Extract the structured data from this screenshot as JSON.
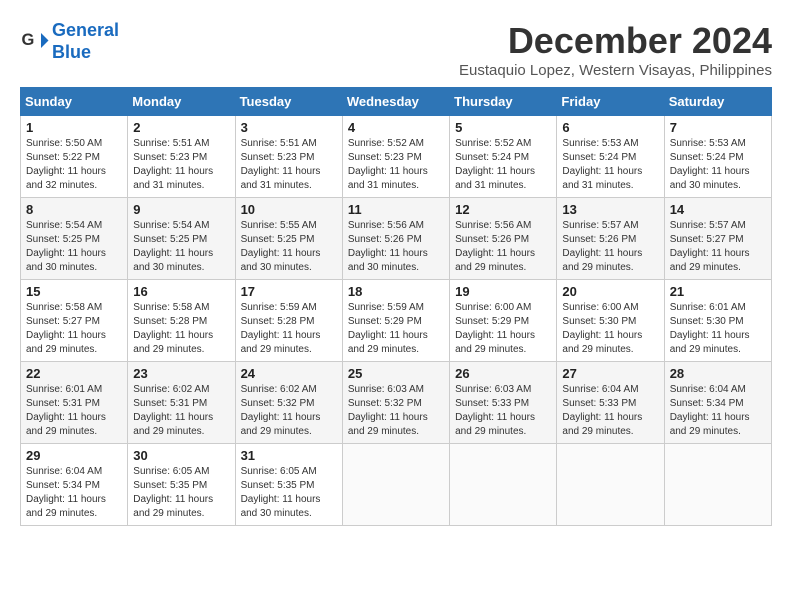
{
  "logo": {
    "line1": "General",
    "line2": "Blue"
  },
  "title": "December 2024",
  "location": "Eustaquio Lopez, Western Visayas, Philippines",
  "days_header": [
    "Sunday",
    "Monday",
    "Tuesday",
    "Wednesday",
    "Thursday",
    "Friday",
    "Saturday"
  ],
  "weeks": [
    [
      {
        "day": "1",
        "rise": "5:50 AM",
        "set": "5:22 PM",
        "daylight": "11 hours and 32 minutes."
      },
      {
        "day": "2",
        "rise": "5:51 AM",
        "set": "5:23 PM",
        "daylight": "11 hours and 31 minutes."
      },
      {
        "day": "3",
        "rise": "5:51 AM",
        "set": "5:23 PM",
        "daylight": "11 hours and 31 minutes."
      },
      {
        "day": "4",
        "rise": "5:52 AM",
        "set": "5:23 PM",
        "daylight": "11 hours and 31 minutes."
      },
      {
        "day": "5",
        "rise": "5:52 AM",
        "set": "5:24 PM",
        "daylight": "11 hours and 31 minutes."
      },
      {
        "day": "6",
        "rise": "5:53 AM",
        "set": "5:24 PM",
        "daylight": "11 hours and 31 minutes."
      },
      {
        "day": "7",
        "rise": "5:53 AM",
        "set": "5:24 PM",
        "daylight": "11 hours and 30 minutes."
      }
    ],
    [
      {
        "day": "8",
        "rise": "5:54 AM",
        "set": "5:25 PM",
        "daylight": "11 hours and 30 minutes."
      },
      {
        "day": "9",
        "rise": "5:54 AM",
        "set": "5:25 PM",
        "daylight": "11 hours and 30 minutes."
      },
      {
        "day": "10",
        "rise": "5:55 AM",
        "set": "5:25 PM",
        "daylight": "11 hours and 30 minutes."
      },
      {
        "day": "11",
        "rise": "5:56 AM",
        "set": "5:26 PM",
        "daylight": "11 hours and 30 minutes."
      },
      {
        "day": "12",
        "rise": "5:56 AM",
        "set": "5:26 PM",
        "daylight": "11 hours and 29 minutes."
      },
      {
        "day": "13",
        "rise": "5:57 AM",
        "set": "5:26 PM",
        "daylight": "11 hours and 29 minutes."
      },
      {
        "day": "14",
        "rise": "5:57 AM",
        "set": "5:27 PM",
        "daylight": "11 hours and 29 minutes."
      }
    ],
    [
      {
        "day": "15",
        "rise": "5:58 AM",
        "set": "5:27 PM",
        "daylight": "11 hours and 29 minutes."
      },
      {
        "day": "16",
        "rise": "5:58 AM",
        "set": "5:28 PM",
        "daylight": "11 hours and 29 minutes."
      },
      {
        "day": "17",
        "rise": "5:59 AM",
        "set": "5:28 PM",
        "daylight": "11 hours and 29 minutes."
      },
      {
        "day": "18",
        "rise": "5:59 AM",
        "set": "5:29 PM",
        "daylight": "11 hours and 29 minutes."
      },
      {
        "day": "19",
        "rise": "6:00 AM",
        "set": "5:29 PM",
        "daylight": "11 hours and 29 minutes."
      },
      {
        "day": "20",
        "rise": "6:00 AM",
        "set": "5:30 PM",
        "daylight": "11 hours and 29 minutes."
      },
      {
        "day": "21",
        "rise": "6:01 AM",
        "set": "5:30 PM",
        "daylight": "11 hours and 29 minutes."
      }
    ],
    [
      {
        "day": "22",
        "rise": "6:01 AM",
        "set": "5:31 PM",
        "daylight": "11 hours and 29 minutes."
      },
      {
        "day": "23",
        "rise": "6:02 AM",
        "set": "5:31 PM",
        "daylight": "11 hours and 29 minutes."
      },
      {
        "day": "24",
        "rise": "6:02 AM",
        "set": "5:32 PM",
        "daylight": "11 hours and 29 minutes."
      },
      {
        "day": "25",
        "rise": "6:03 AM",
        "set": "5:32 PM",
        "daylight": "11 hours and 29 minutes."
      },
      {
        "day": "26",
        "rise": "6:03 AM",
        "set": "5:33 PM",
        "daylight": "11 hours and 29 minutes."
      },
      {
        "day": "27",
        "rise": "6:04 AM",
        "set": "5:33 PM",
        "daylight": "11 hours and 29 minutes."
      },
      {
        "day": "28",
        "rise": "6:04 AM",
        "set": "5:34 PM",
        "daylight": "11 hours and 29 minutes."
      }
    ],
    [
      {
        "day": "29",
        "rise": "6:04 AM",
        "set": "5:34 PM",
        "daylight": "11 hours and 29 minutes."
      },
      {
        "day": "30",
        "rise": "6:05 AM",
        "set": "5:35 PM",
        "daylight": "11 hours and 29 minutes."
      },
      {
        "day": "31",
        "rise": "6:05 AM",
        "set": "5:35 PM",
        "daylight": "11 hours and 30 minutes."
      },
      null,
      null,
      null,
      null
    ]
  ],
  "labels": {
    "sunrise": "Sunrise:",
    "sunset": "Sunset:",
    "daylight": "Daylight:"
  }
}
